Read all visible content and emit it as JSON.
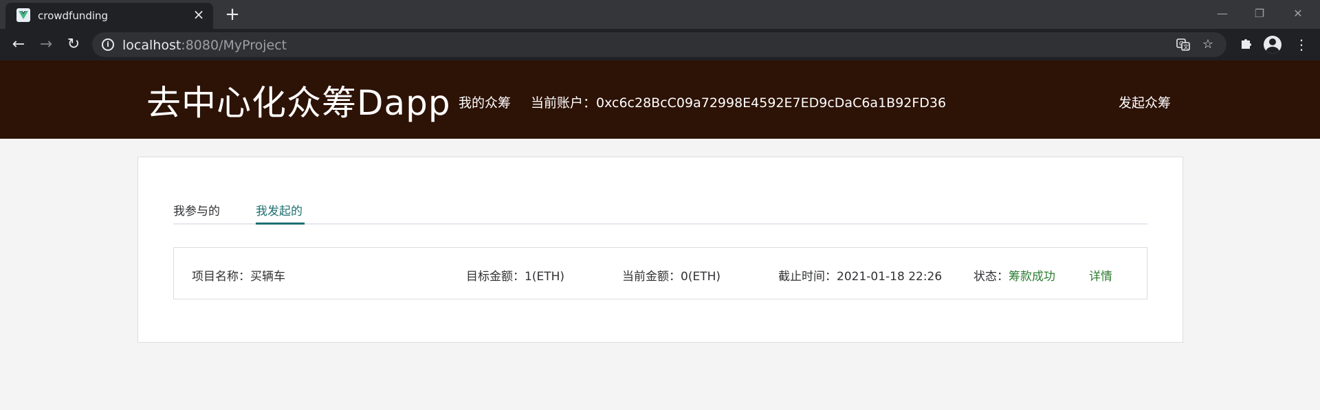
{
  "browser": {
    "tab_title": "crowdfunding",
    "url_host": "localhost",
    "url_rest": ":8080/MyProject"
  },
  "header": {
    "app_title": "去中心化众筹Dapp",
    "nav_my": "我的众筹",
    "account_label": "当前账户：",
    "account_address": "0xc6c28BcC09a72998E4592E7ED9cDaC6a1B92FD36",
    "create_link": "发起众筹"
  },
  "tabs": [
    {
      "label": "我参与的",
      "active": false
    },
    {
      "label": "我发起的",
      "active": true
    }
  ],
  "project": {
    "name_label": "项目名称：",
    "name_value": "买辆车",
    "target_label": "目标金额：",
    "target_value": "1(ETH)",
    "current_label": "当前金额：",
    "current_value": "0(ETH)",
    "deadline_label": "截止时间：",
    "deadline_value": "2021-01-18 22:26",
    "status_label": "状态：",
    "status_value": "筹款成功",
    "details_link": "详情"
  },
  "colors": {
    "header_bg": "#2d1206",
    "accent": "#1f6f6f",
    "success": "#2e7d32"
  }
}
